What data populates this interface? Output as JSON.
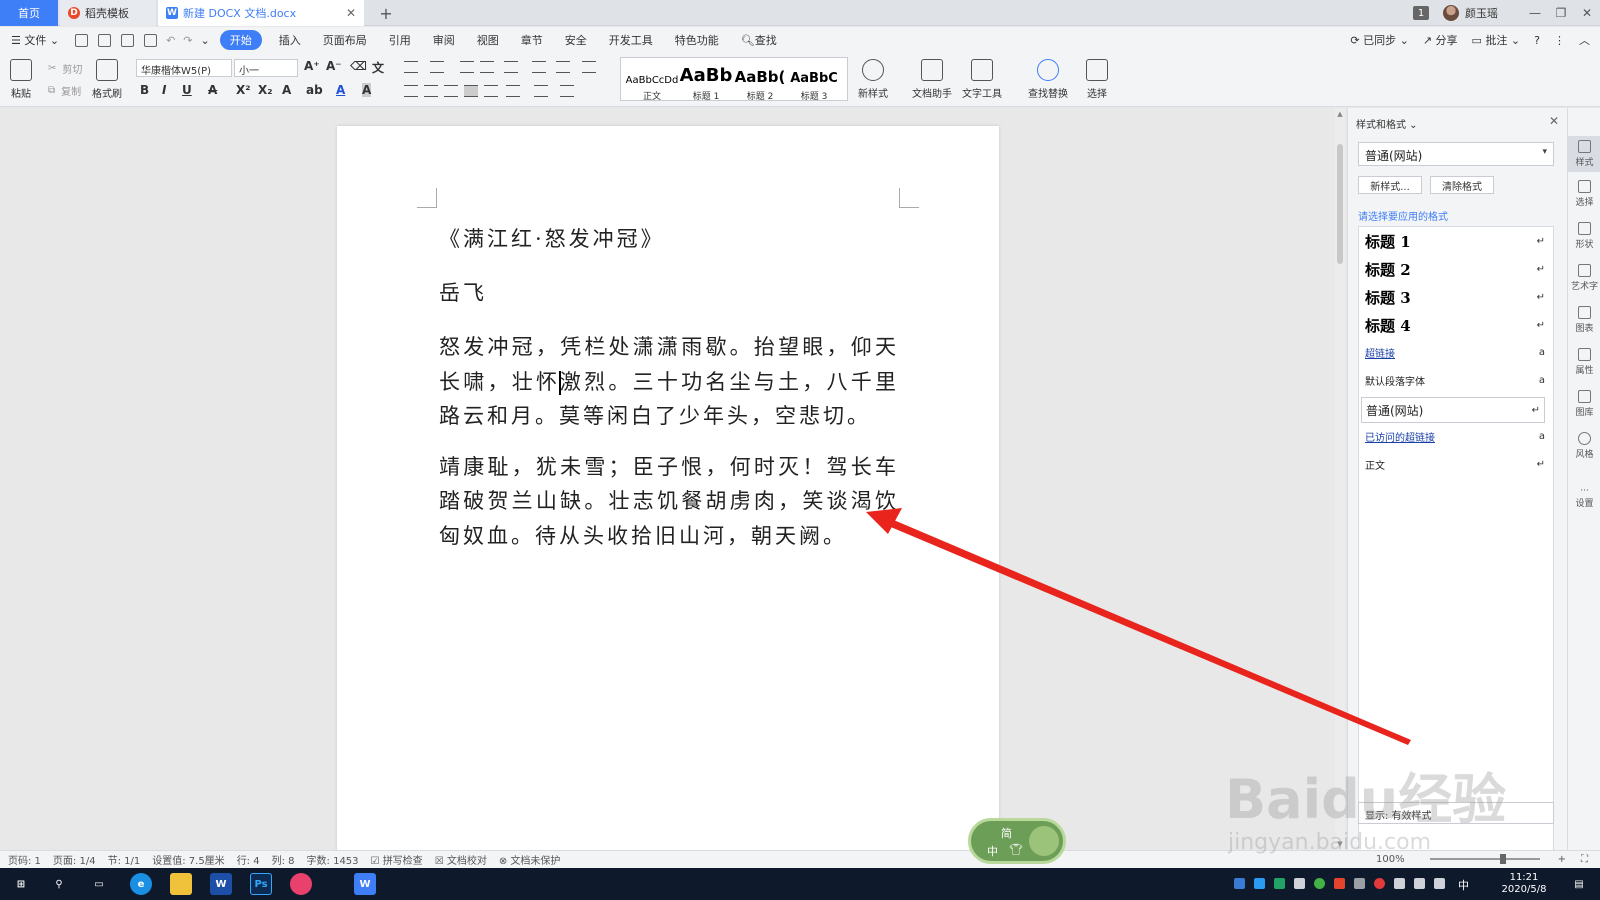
{
  "tabs": [
    {
      "label": "首页"
    },
    {
      "label": "稻壳模板"
    },
    {
      "label": "新建 DOCX 文档.docx"
    }
  ],
  "titlebar": {
    "badge": "1",
    "user": "颜玉瑶"
  },
  "menu": {
    "file": "文件",
    "items": [
      "开始",
      "插入",
      "页面布局",
      "引用",
      "审阅",
      "视图",
      "章节",
      "安全",
      "开发工具",
      "特色功能"
    ],
    "search": "查找",
    "right": [
      "已同步",
      "分享",
      "批注"
    ]
  },
  "ribbon": {
    "paste": "粘贴",
    "cut": "剪切",
    "copy": "复制",
    "format_painter": "格式刷",
    "font_name": "华康楷体W5(P)",
    "font_size": "小一",
    "styles": [
      {
        "sample": "AaBbCcDd",
        "name": "正文"
      },
      {
        "sample": "AaBb",
        "name": "标题 1"
      },
      {
        "sample": "AaBb(",
        "name": "标题 2"
      },
      {
        "sample": "AaBbC",
        "name": "标题 3"
      }
    ],
    "new_style": "新样式",
    "doc_assistant": "文档助手",
    "text_tools": "文字工具",
    "find_replace": "查找替换",
    "select": "选择"
  },
  "document": {
    "title": "《满江红·怒发冲冠》",
    "author": "岳飞",
    "para1_before_caret": "怒发冲冠，凭栏处潇潇雨歇。抬望眼，仰天长啸，壮怀",
    "para1_after_caret": "激烈。三十功名尘与土，八千里路云和月。莫等闲白了少年头，空悲切。",
    "para2": "靖康耻，犹未雪；臣子恨，何时灭！驾长车踏破贺兰山缺。壮志饥餐胡虏肉，笑谈渴饮匈奴血。待从头收拾旧山河，朝天阙。"
  },
  "styles_panel": {
    "title": "样式和格式",
    "current": "普通(网站)",
    "new_style": "新样式...",
    "clear_format": "清除格式",
    "hint": "请选择要应用的格式",
    "items": [
      {
        "label": "标题 1",
        "mark": "↵"
      },
      {
        "label": "标题 2",
        "mark": "↵"
      },
      {
        "label": "标题 3",
        "mark": "↵"
      },
      {
        "label": "标题 4",
        "mark": "↵"
      },
      {
        "label": "超链接",
        "mark": "a"
      },
      {
        "label": "默认段落字体",
        "mark": "a"
      },
      {
        "label": "普通(网站)",
        "mark": "↵"
      },
      {
        "label": "已访问的超链接",
        "mark": "a"
      },
      {
        "label": "正文",
        "mark": "↵"
      }
    ],
    "bottom": "显示: 有效样式"
  },
  "side_icons": [
    "样式",
    "选择",
    "形状",
    "艺术字",
    "图表",
    "属性",
    "图库",
    "风格",
    "设置"
  ],
  "status": {
    "page": "页码: 1",
    "pages": "页面: 1/4",
    "section": "节: 1/1",
    "setting": "设置值: 7.5厘米",
    "row": "行: 4",
    "col": "列: 8",
    "words": "字数: 1453",
    "spell": "拼写检查",
    "proof": "文档校对",
    "protect": "文档未保护",
    "zoom": "100%"
  },
  "ime": {
    "top": "简",
    "bottom": "中"
  },
  "taskbar": {
    "time": "11:21",
    "date": "2020/5/8",
    "lang": "中"
  },
  "watermark": {
    "text": "Baidu经验",
    "url": "jingyan.baidu.com"
  },
  "colors": {
    "accent": "#3e7ef7",
    "arrow": "#e8241c",
    "taskbar": "#0e1a2b"
  }
}
